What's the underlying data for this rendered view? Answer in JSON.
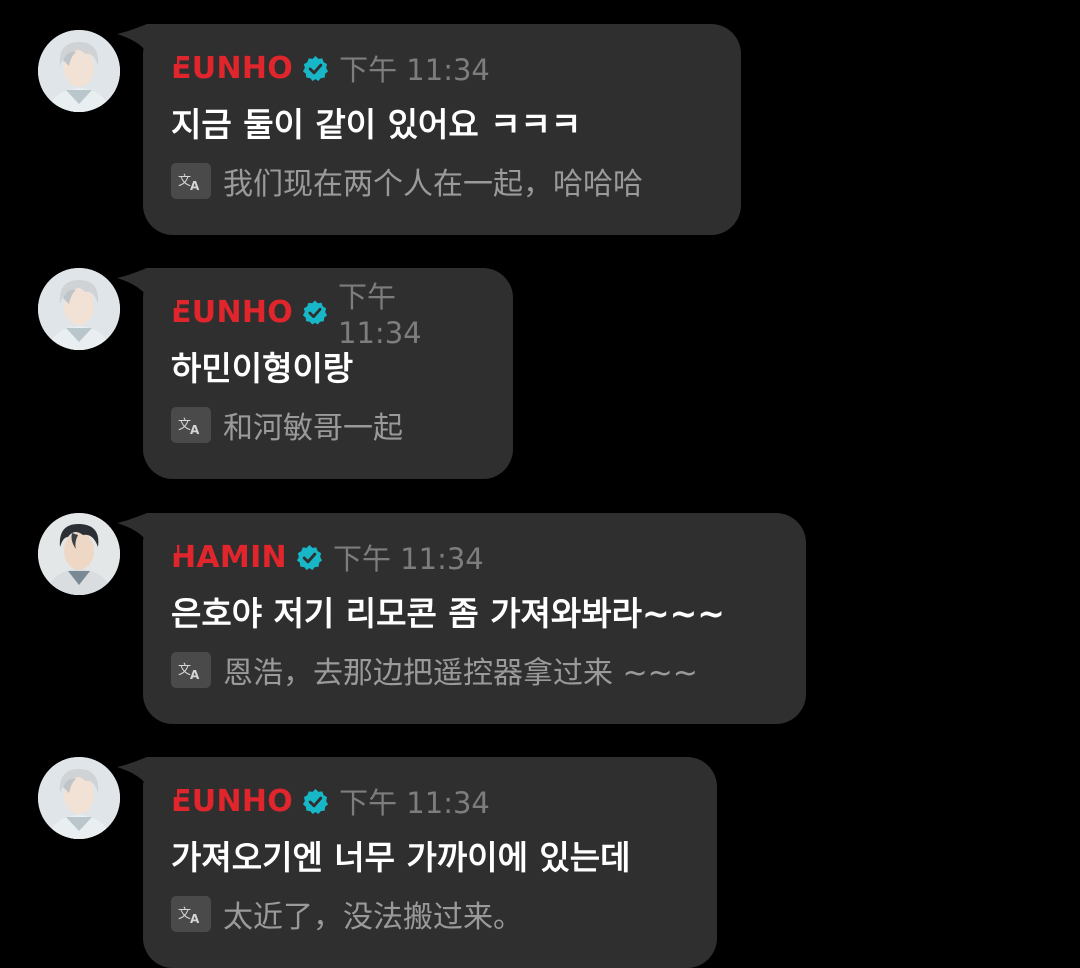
{
  "messages": [
    {
      "sender": "EUNHO",
      "time": "下午 11:34",
      "text": "지금 둘이 같이 있어요 ㅋㅋㅋ",
      "translation": "我们现在两个人在一起，哈哈哈",
      "translate_icon": "translate-icon",
      "avatar": "eunho-avatar"
    },
    {
      "sender": "EUNHO",
      "time": "下午 11:34",
      "text": "하민이형이랑",
      "translation": "和河敏哥一起",
      "translate_icon": "translate-icon",
      "avatar": "eunho-avatar"
    },
    {
      "sender": "HAMIN",
      "time": "下午 11:34",
      "text": "은호야 저기 리모콘 좀 가져와봐라~~~",
      "translation": "恩浩，去那边把遥控器拿过来 ~~~",
      "translate_icon": "translate-icon",
      "avatar": "hamin-avatar"
    },
    {
      "sender": "EUNHO",
      "time": "下午 11:34",
      "text": "가져오기엔 너무 가까이에 있는데",
      "translation": "太近了，没法搬过来。",
      "translate_icon": "translate-icon",
      "avatar": "eunho-avatar"
    }
  ],
  "colors": {
    "background": "#000000",
    "bubble": "#2f2f2f",
    "sender_name": "#e0262c",
    "verified_badge": "#18b7c8",
    "timestamp": "#7d7d7d",
    "message_text": "#ffffff",
    "translation_text": "#9a9a9a"
  }
}
